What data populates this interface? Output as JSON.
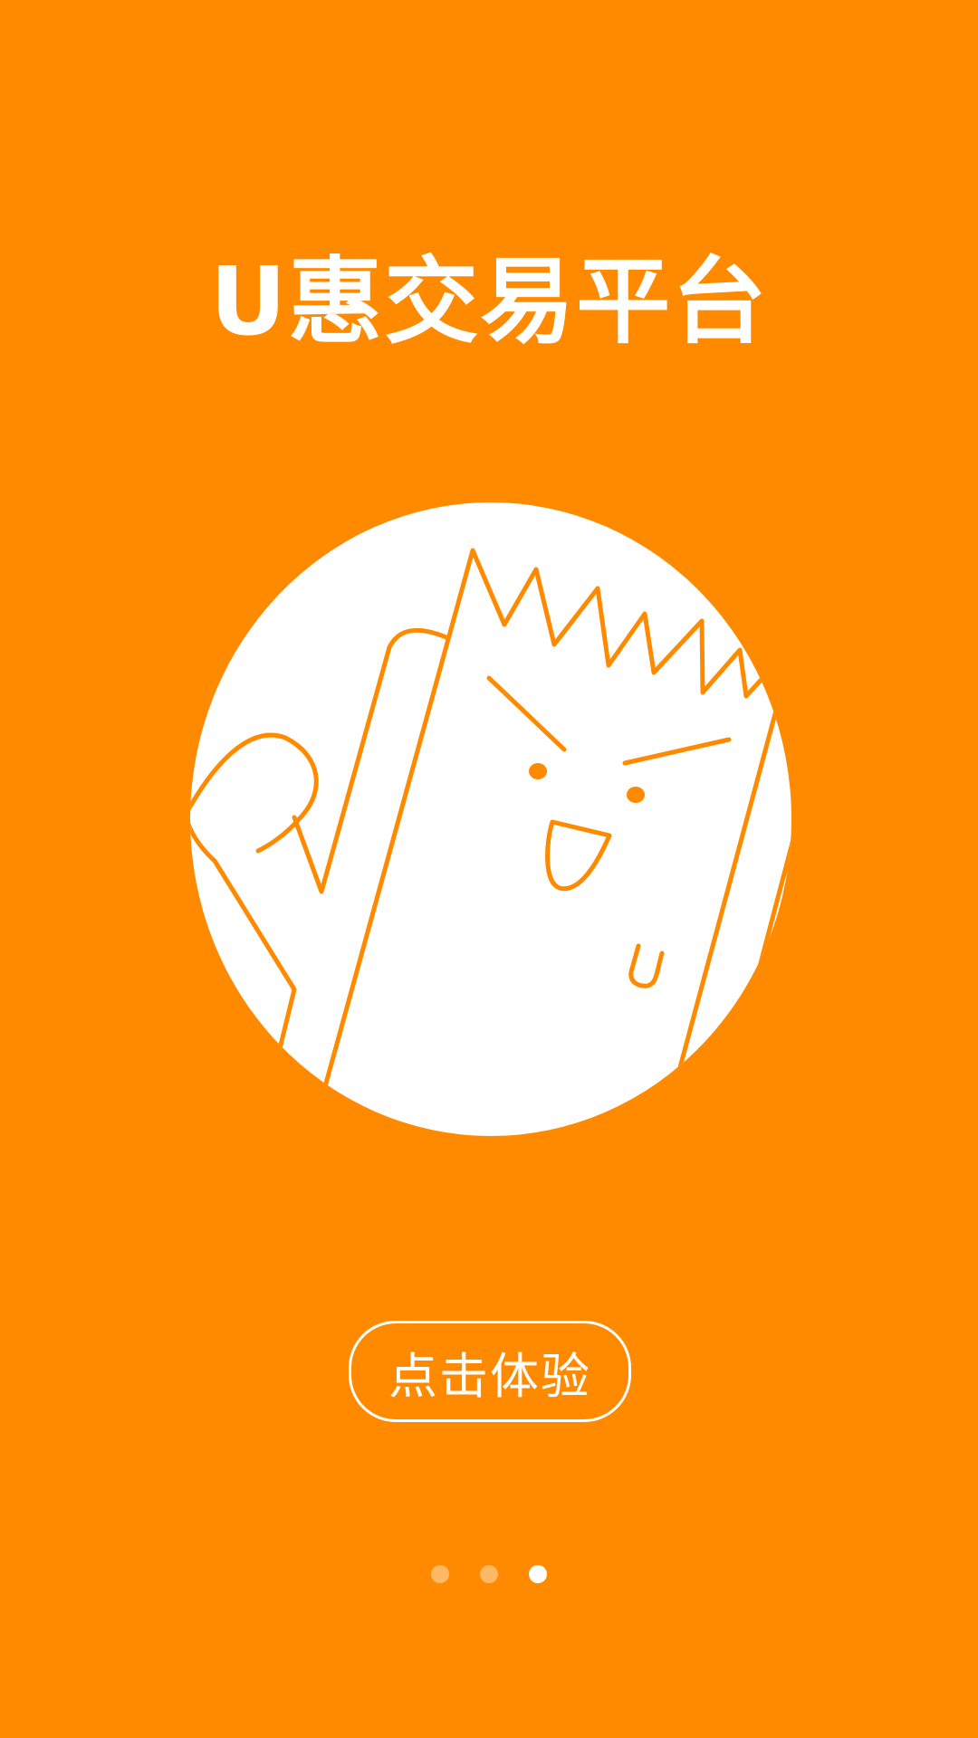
{
  "screen": {
    "title": "U惠交易平台",
    "cta_label": "点击体验"
  },
  "illustration": {
    "description_icon": "cartoon-character-icon"
  },
  "pager": {
    "total": 3,
    "active_index": 2
  },
  "colors": {
    "background": "#FF8A00",
    "foreground": "#FFFFFF",
    "line": "#FF8A00"
  }
}
